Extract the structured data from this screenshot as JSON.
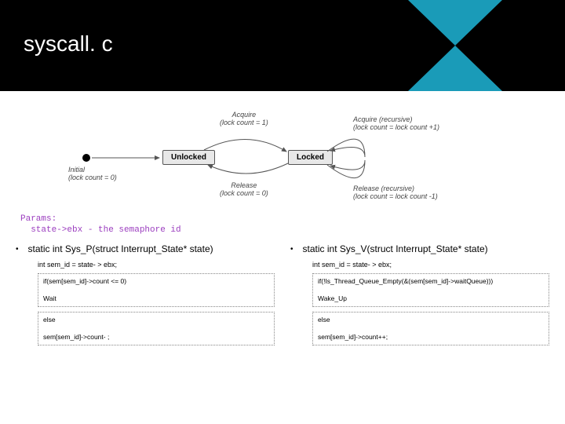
{
  "header": {
    "title": "syscall. c"
  },
  "diagram": {
    "unlocked": "Unlocked",
    "locked": "Locked",
    "initial": "Initial\n(lock count = 0)",
    "acquire_top": "Acquire\n(lock count = 1)",
    "release_mid": "Release\n(lock count = 0)",
    "acquire_rec": "Acquire (recursive)\n(lock count = lock count +1)",
    "release_rec": "Release (recursive)\n(lock count = lock count -1)"
  },
  "params": {
    "l1": "Params:",
    "l2": "  state->ebx - the semaphore id"
  },
  "left": {
    "sig": "static int Sys_P(struct Interrupt_State* state)",
    "sub": "int sem_id = state- > ebx;",
    "box1": "if(sem[sem_id]->count <= 0)\n\nWait",
    "box2": "else\n\nsem[sem_id]->count- ;"
  },
  "right": {
    "sig": "static int Sys_V(struct Interrupt_State* state)",
    "sub": "int sem_id = state- > ebx;",
    "box1": "if(!Is_Thread_Queue_Empty(&(sem[sem_id]->waitQueue)))\n\nWake_Up",
    "box2": "else\n\nsem[sem_id]->count++;"
  }
}
